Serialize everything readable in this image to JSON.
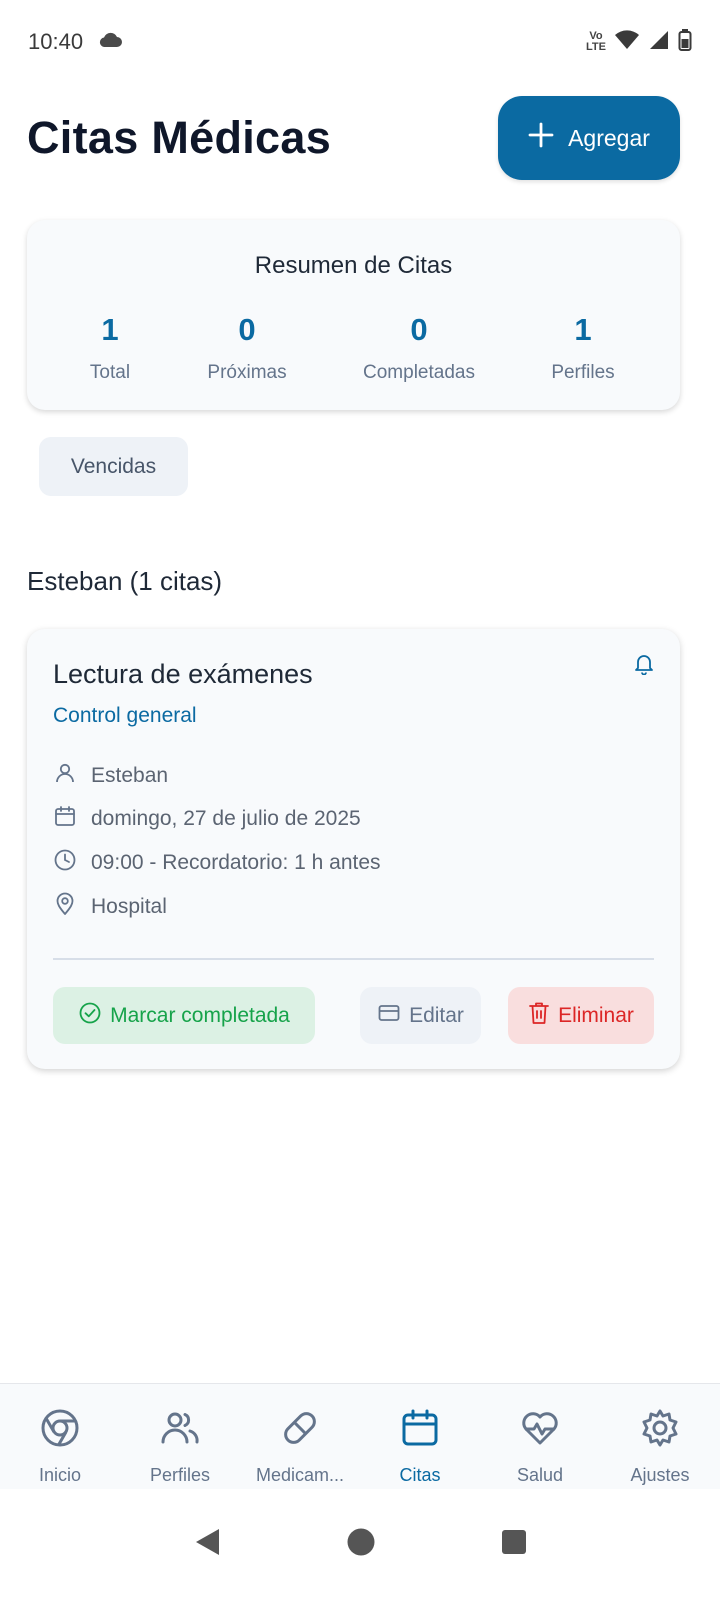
{
  "status_bar": {
    "time": "10:40",
    "network_label_top": "Vo",
    "network_label_bottom": "LTE",
    "icons": [
      "cloud-icon",
      "volte-icon",
      "wifi-icon",
      "signal-icon",
      "battery-icon"
    ]
  },
  "header": {
    "title": "Citas Médicas",
    "add_label": "Agregar"
  },
  "summary": {
    "title": "Resumen de Citas",
    "stats": [
      {
        "value": "1",
        "label": "Total"
      },
      {
        "value": "0",
        "label": "Próximas"
      },
      {
        "value": "0",
        "label": "Completadas"
      },
      {
        "value": "1",
        "label": "Perfiles"
      }
    ]
  },
  "filter": {
    "label": "Vencidas"
  },
  "group": {
    "header": "Esteban (1 citas)"
  },
  "appointment": {
    "title": "Lectura de exámenes",
    "type": "Control general",
    "person": "Esteban",
    "date": "domingo, 27 de julio de 2025",
    "time": "09:00 - Recordatorio: 1 h antes",
    "location": "Hospital",
    "actions": {
      "complete": "Marcar completada",
      "edit": "Editar",
      "delete": "Eliminar"
    }
  },
  "bottom_nav": {
    "items": [
      {
        "label": "Inicio",
        "icon": "home-icon"
      },
      {
        "label": "Perfiles",
        "icon": "users-icon"
      },
      {
        "label": "Medicam...",
        "icon": "pill-icon"
      },
      {
        "label": "Citas",
        "icon": "calendar-icon",
        "active": true
      },
      {
        "label": "Salud",
        "icon": "heart-pulse-icon"
      },
      {
        "label": "Ajustes",
        "icon": "settings-icon"
      }
    ]
  },
  "colors": {
    "primary": "#0b6aa2",
    "success": "#16a34a",
    "danger": "#dc2626",
    "muted": "#64748b"
  }
}
